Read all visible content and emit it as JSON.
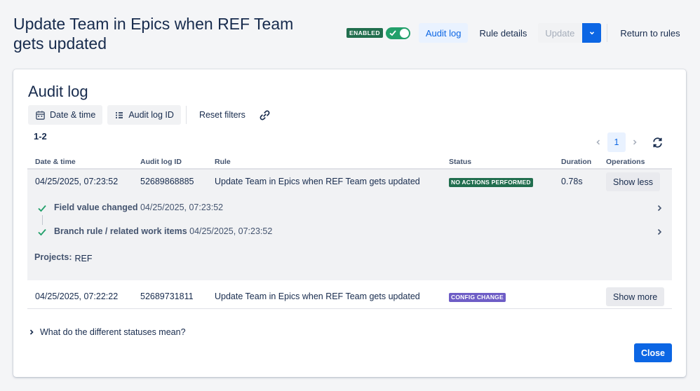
{
  "page": {
    "title": "Update Team in Epics when REF Team gets updated",
    "enabled_label": "ENABLED",
    "toggle_on": true
  },
  "header": {
    "audit_log": "Audit log",
    "rule_details": "Rule details",
    "update": "Update",
    "return": "Return to rules"
  },
  "audit": {
    "title": "Audit log",
    "filters": {
      "date_time": "Date & time",
      "audit_log_id": "Audit log ID",
      "reset": "Reset filters"
    },
    "count": "1-2",
    "page": "1",
    "columns": {
      "date": "Date & time",
      "id": "Audit log ID",
      "rule": "Rule",
      "status": "Status",
      "duration": "Duration",
      "operations": "Operations"
    },
    "rows": [
      {
        "date": "04/25/2025, 07:23:52",
        "id": "52689868885",
        "rule": "Update Team in Epics when REF Team gets updated",
        "status": "NO ACTIONS PERFORMED",
        "status_color": "#216e4e",
        "duration": "0.78s",
        "action": "Show less",
        "details": [
          {
            "label": "Field value changed",
            "time": "04/25/2025, 07:23:52"
          },
          {
            "label": "Branch rule / related work items",
            "time": "04/25/2025, 07:23:52"
          }
        ],
        "projects_label": "Projects:",
        "projects_value": "REF"
      },
      {
        "date": "04/25/2025, 07:22:22",
        "id": "52689731811",
        "rule": "Update Team in Epics when REF Team gets updated",
        "status": "CONFIG CHANGE",
        "status_color": "#6e5dc6",
        "duration": "",
        "action": "Show more"
      }
    ],
    "explain": "What do the different statuses mean?",
    "close": "Close"
  },
  "colors": {
    "accent": "#0c66e4",
    "enabled": "#216e4e",
    "toggle": "#22a06b",
    "config": "#6e5dc6"
  }
}
